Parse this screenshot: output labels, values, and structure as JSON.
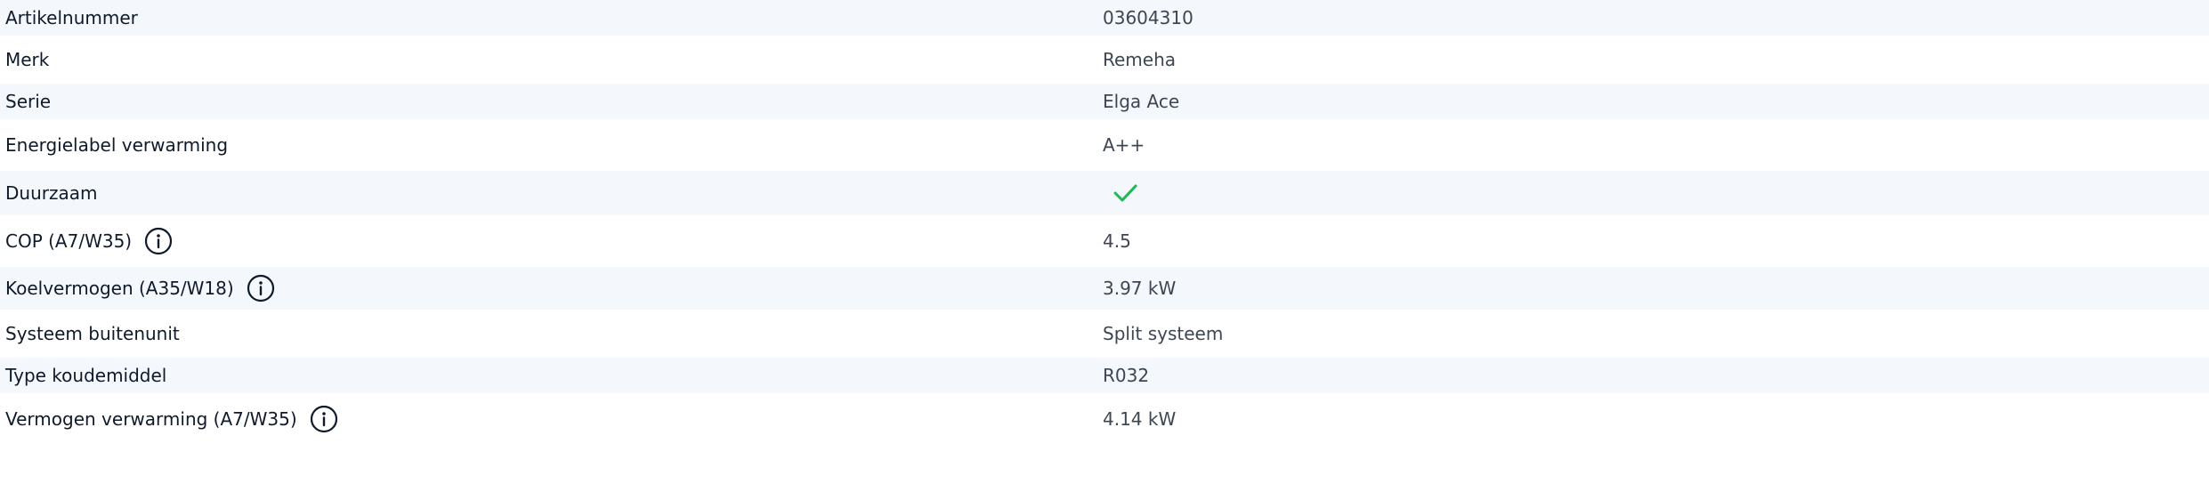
{
  "specs": {
    "rows": [
      {
        "label": "Artikelnummer",
        "value": "03604310"
      },
      {
        "label": "Merk",
        "value": "Remeha"
      },
      {
        "label": "Serie",
        "value": "Elga Ace"
      },
      {
        "label": "Energielabel verwarming",
        "value": "A++"
      },
      {
        "label": "Duurzaam",
        "value": "",
        "icon": "checkmark-icon",
        "icon_color": "#1db954"
      },
      {
        "label": "COP (A7/W35)",
        "value": "4.5",
        "info_icon": "info-circle-icon"
      },
      {
        "label": "Koelvermogen (A35/W18)",
        "value": "3.97 kW",
        "info_icon": "info-circle-icon"
      },
      {
        "label": "Systeem buitenunit",
        "value": "Split systeem"
      },
      {
        "label": "Type koudemiddel",
        "value": "R032"
      },
      {
        "label": "Vermogen verwarming (A7/W35)",
        "value": "4.14 kW",
        "info_icon": "info-circle-icon"
      }
    ]
  },
  "colors": {
    "row_shade": "#f4f7fc",
    "label_text": "#0f1a2a",
    "value_text": "#3d4653",
    "check": "#1db954"
  }
}
